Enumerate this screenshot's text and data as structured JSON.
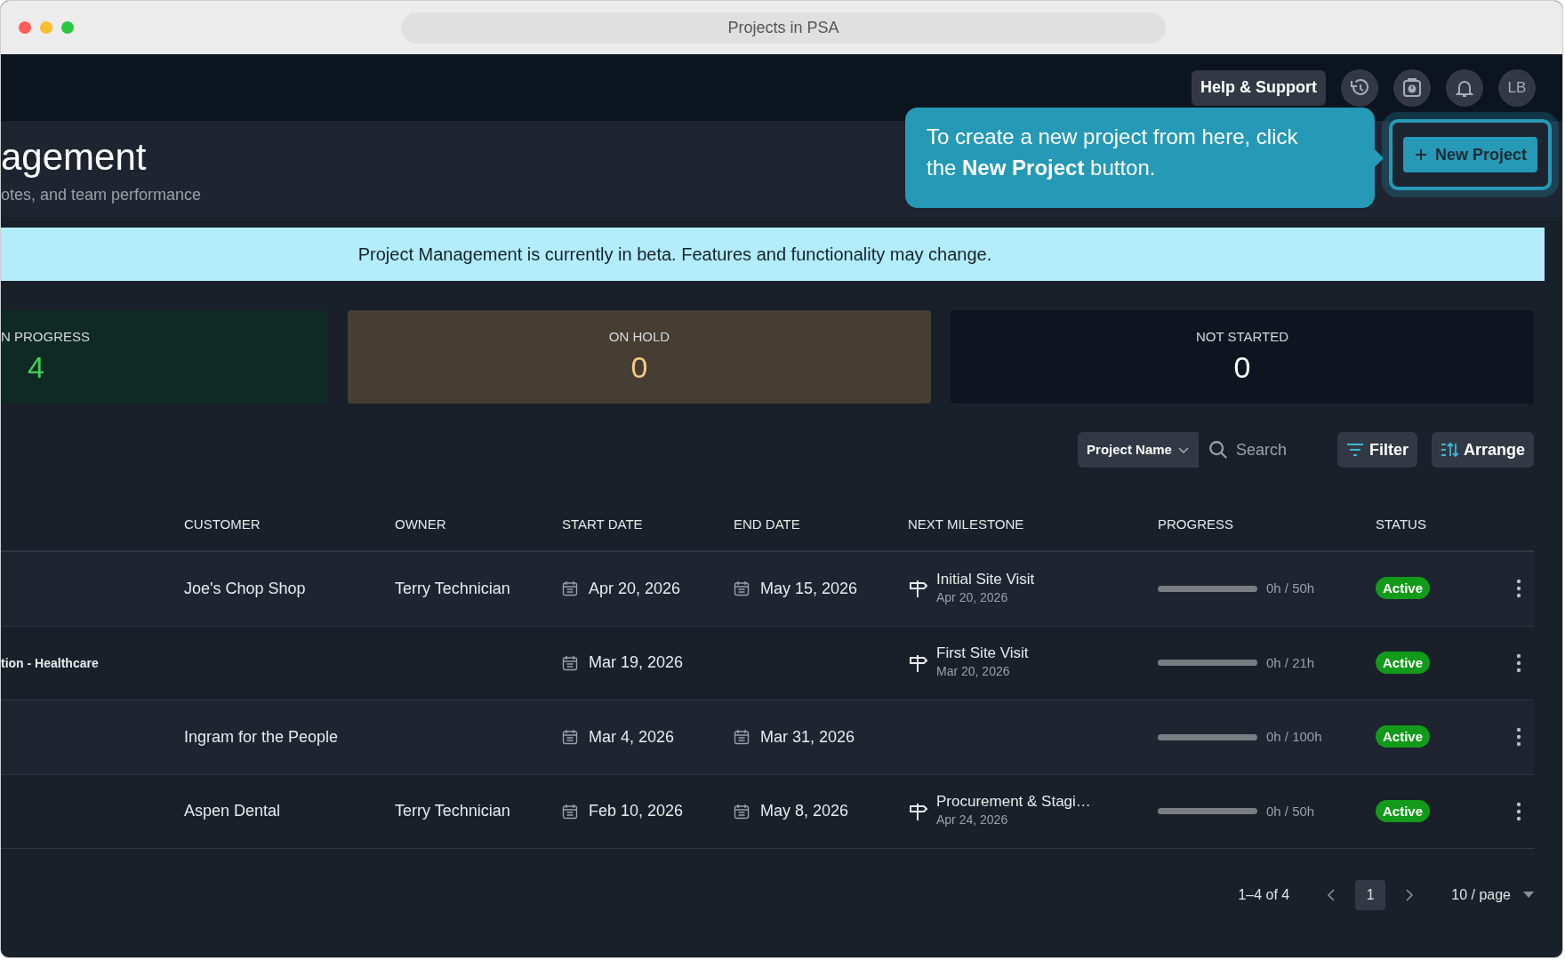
{
  "window": {
    "title": "Projects in PSA"
  },
  "topbar": {
    "help_button": "Help & Support",
    "avatar": "LB"
  },
  "header": {
    "title": "agement",
    "subtitle": "otes, and team performance",
    "new_project_button": "New Project"
  },
  "tooltip": {
    "text": "To create a new project from here, click the **New Project** button."
  },
  "alert": {
    "text": "Project Management is currently in beta. Features and functionality may change."
  },
  "stats": [
    {
      "kind": "in_progress",
      "label": "N PROGRESS",
      "value": "4"
    },
    {
      "kind": "on_hold",
      "label": "ON HOLD",
      "value": "0"
    },
    {
      "kind": "not_started",
      "label": "NOT STARTED",
      "value": "0"
    }
  ],
  "toolbar": {
    "field_select": "Project Name",
    "search_placeholder": "Search",
    "filter_button": "Filter",
    "arrange_button": "Arrange"
  },
  "table": {
    "columns": [
      "CUSTOMER",
      "OWNER",
      "START DATE",
      "END DATE",
      "NEXT MILESTONE",
      "PROGRESS",
      "STATUS"
    ],
    "rows": [
      {
        "customer": "Joe's Chop Shop",
        "owner": "Terry Technician",
        "start_date": "Apr 20, 2026",
        "end_date": "May 15, 2026",
        "milestone": {
          "name": "Initial Site Visit",
          "date": "Apr 20, 2026"
        },
        "progress": {
          "level": 0,
          "reading": "0h / 50h"
        },
        "status": "Active"
      },
      {
        "project": "tion - Healthcare",
        "start_date": "Mar 19, 2026",
        "milestone": {
          "name": "First Site Visit",
          "date": "Mar 20, 2026"
        },
        "progress": {
          "level": 0,
          "reading": "0h / 21h"
        },
        "status": "Active"
      },
      {
        "customer": "Ingram for the People",
        "start_date": "Mar 4, 2026",
        "end_date": "Mar 31, 2026",
        "progress": {
          "level": 0,
          "reading": "0h / 100h"
        },
        "status": "Active"
      },
      {
        "customer": "Aspen Dental",
        "owner": "Terry Technician",
        "start_date": "Feb 10, 2026",
        "end_date": "May 8, 2026",
        "milestone": {
          "name": "Procurement & Stagi…",
          "date": "Apr 24, 2026"
        },
        "progress": {
          "level": 0,
          "reading": "0h / 50h"
        },
        "status": "Active"
      }
    ]
  },
  "pagination": {
    "range": "1–4 of 4",
    "pages": [
      {
        "label": "1",
        "selected": true
      }
    ],
    "page_size": "10 / page"
  }
}
